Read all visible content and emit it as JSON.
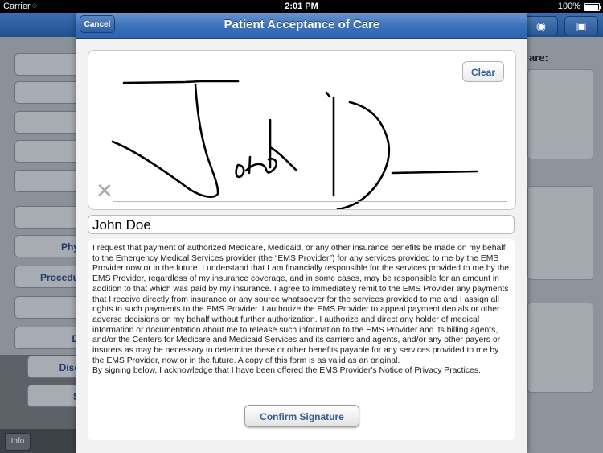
{
  "status_bar": {
    "carrier": "Carrier",
    "time": "2:01 PM",
    "battery": "100%"
  },
  "background": {
    "sidebar_items": [
      "",
      "",
      "",
      "",
      "",
      "",
      "Phy",
      "Procedu",
      "",
      "D",
      "Disc",
      "S"
    ],
    "right_label": "are:",
    "info_label": "Info"
  },
  "modal": {
    "title": "Patient Acceptance of Care",
    "cancel_label": "Cancel",
    "clear_label": "Clear",
    "clear_icon": "x-icon",
    "signer_name": "John Doe",
    "terms_paragraphs": [
      "I request that payment of authorized Medicare, Medicaid, or any other insurance benefits be made on my behalf to the Emergency Medical Services provider (the “EMS Provider”) for any services provided to me by the EMS Provider now or in the future. I understand that I am financially responsible for the services provided to me by the EMS Provider, regardless of my insurance coverage, and in some cases, may be responsible for an amount in addition to that which was paid by my insurance. I agree to immediately remit to the EMS Provider any payments that I receive directly from insurance or any source whatsoever for the services provided to me and I assign all rights to such payments to the EMS Provider. I authorize the EMS Provider to appeal payment denials or other adverse decisions on my behalf without further authorization. I authorize and direct any holder of medical information or documentation about me to release such information to the EMS Provider and its billing agents, and/or the Centers for Medicare and Medicaid Services and its carriers and agents, and/or any other payers or insurers as may be necessary to determine these or other benefits payable for any services provided to me by the EMS Provider, now or in the future.  A copy of this form is as valid as an original.",
      "By signing below, I acknowledge that I have been offered the EMS Provider's Notice of Privacy Practices."
    ],
    "confirm_label": "Confirm Signature"
  },
  "colors": {
    "header_blue": "#3f74bc",
    "button_text": "#365e95"
  }
}
